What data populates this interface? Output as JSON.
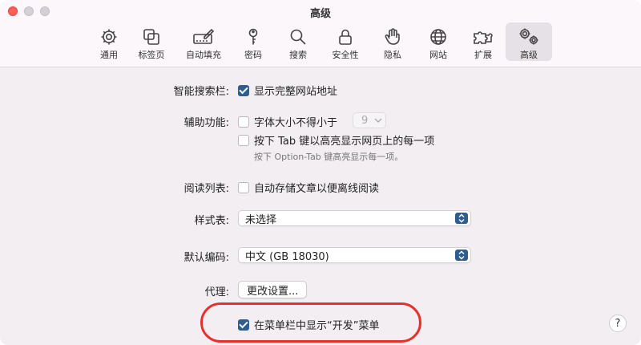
{
  "window": {
    "title": "高级"
  },
  "tabs": [
    {
      "id": "general",
      "label": "通用",
      "icon": "gear-icon"
    },
    {
      "id": "tabs",
      "label": "标签页",
      "icon": "tabs-icon"
    },
    {
      "id": "autofill",
      "label": "自动填充",
      "icon": "autofill-icon"
    },
    {
      "id": "passwords",
      "label": "密码",
      "icon": "key-icon"
    },
    {
      "id": "search",
      "label": "搜索",
      "icon": "search-icon"
    },
    {
      "id": "security",
      "label": "安全性",
      "icon": "lock-icon"
    },
    {
      "id": "privacy",
      "label": "隐私",
      "icon": "hand-icon"
    },
    {
      "id": "websites",
      "label": "网站",
      "icon": "globe-icon"
    },
    {
      "id": "extensions",
      "label": "扩展",
      "icon": "puzzle-icon"
    },
    {
      "id": "advanced",
      "label": "高级",
      "icon": "gears-icon",
      "active": true
    }
  ],
  "settings": {
    "smart_search": {
      "label": "智能搜索栏:",
      "option": "显示完整网站地址",
      "checked": true
    },
    "accessibility": {
      "label": "辅助功能:",
      "min_font": {
        "text": "字体大小不得小于",
        "checked": false,
        "value": "9"
      },
      "tab_highlight": {
        "text": "按下 Tab 键以高亮显示网页上的每一项",
        "checked": false
      },
      "hint": "按下 Option-Tab 键高亮显示每一项。"
    },
    "reading_list": {
      "label": "阅读列表:",
      "option": "自动存储文章以便离线阅读",
      "checked": false
    },
    "stylesheet": {
      "label": "样式表:",
      "value": "未选择"
    },
    "encoding": {
      "label": "默认编码:",
      "value": "中文 (GB 18030)"
    },
    "proxy": {
      "label": "代理:",
      "button": "更改设置..."
    },
    "develop_menu": {
      "option": "在菜单栏中显示“开发”菜单",
      "checked": true
    }
  },
  "help": {
    "label": "?"
  },
  "colors": {
    "accent": "#2f5d8f",
    "highlight": "#e8302b"
  }
}
